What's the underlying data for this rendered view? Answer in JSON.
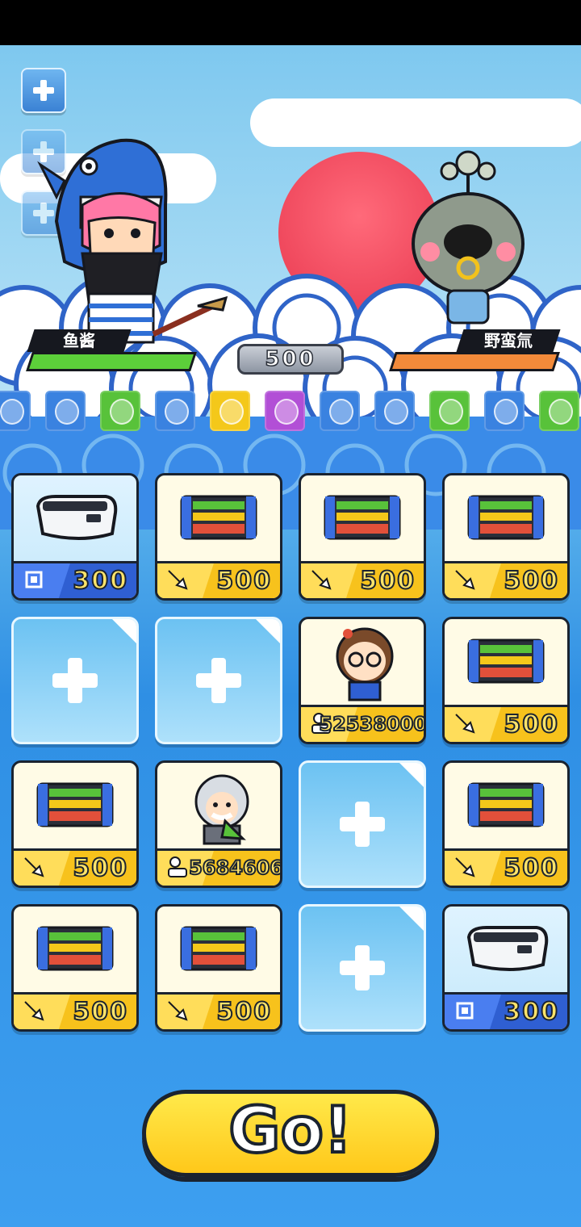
{
  "left_fighter": {
    "name": "鱼酱",
    "hp_color": "#5ccf3a"
  },
  "right_fighter": {
    "name": "野蛮氚",
    "hp_color": "#f28a3a"
  },
  "center_score": "500",
  "side_buttons": [
    "plus-icon",
    "plus-icon",
    "plus-icon"
  ],
  "gems": [
    "#3a82e0",
    "#3a82e0",
    "#58c23a",
    "#3a82e0",
    "#f4c81a",
    "#b24fd6",
    "#3a82e0",
    "#3a82e0",
    "#58c23a",
    "#3a82e0",
    "#58c23a"
  ],
  "grid": [
    {
      "kind": "vr",
      "icon": "chip-icon",
      "price": "300"
    },
    {
      "kind": "item",
      "icon": "sword-icon",
      "price": "500"
    },
    {
      "kind": "item",
      "icon": "sword-icon",
      "price": "500"
    },
    {
      "kind": "item",
      "icon": "sword-icon",
      "price": "500"
    },
    {
      "kind": "empty"
    },
    {
      "kind": "empty"
    },
    {
      "kind": "hero-girl",
      "icon": "person-icon",
      "price": "52538000"
    },
    {
      "kind": "item",
      "icon": "sword-icon",
      "price": "500"
    },
    {
      "kind": "item",
      "icon": "sword-icon",
      "price": "500"
    },
    {
      "kind": "hero-scientist",
      "icon": "person-icon",
      "price": "5684606"
    },
    {
      "kind": "empty"
    },
    {
      "kind": "item",
      "icon": "sword-icon",
      "price": "500"
    },
    {
      "kind": "item",
      "icon": "sword-icon",
      "price": "500"
    },
    {
      "kind": "item",
      "icon": "sword-icon",
      "price": "500"
    },
    {
      "kind": "empty"
    },
    {
      "kind": "vr",
      "icon": "chip-icon",
      "price": "300"
    }
  ],
  "go_label": "Go!"
}
